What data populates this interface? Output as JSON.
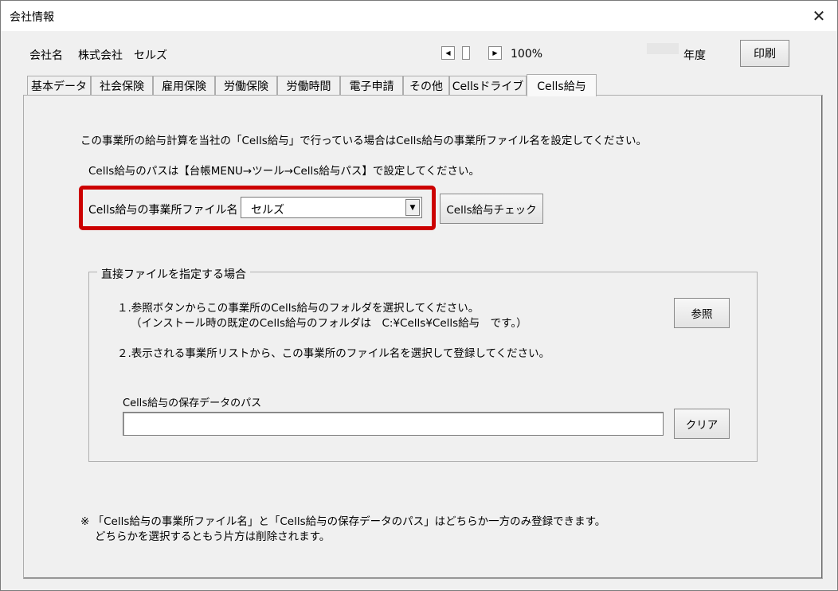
{
  "window": {
    "title": "会社情報",
    "close_label": "✕"
  },
  "header": {
    "company_label": "会社名",
    "company_name": "株式会社　セルズ",
    "zoom": "100%",
    "year_label": "年度",
    "print_label": "印刷"
  },
  "tabs": [
    {
      "label": "基本データ",
      "active": false
    },
    {
      "label": "社会保険",
      "active": false
    },
    {
      "label": "雇用保険",
      "active": false
    },
    {
      "label": "労働保険",
      "active": false
    },
    {
      "label": "労働時間",
      "active": false
    },
    {
      "label": "電子申請",
      "active": false
    },
    {
      "label": "その他",
      "active": false
    },
    {
      "label": "Cellsドライブ",
      "active": false
    },
    {
      "label": "Cells給与",
      "active": true
    }
  ],
  "content": {
    "intro": "この事業所の給与計算を当社の「Cells給与」で行っている場合はCells給与の事業所ファイル名を設定してください。",
    "path_note": "Cells給与のパスは【台帳MENU→ツール→Cells給与パス】で設定してください。",
    "office_file_label": "Cells給与の事業所ファイル名",
    "office_file_value": "セルズ",
    "check_button": "Cells給与チェック",
    "highlight_color": "#cc0000"
  },
  "direct": {
    "group_title": "直接ファイルを指定する場合",
    "step1_line1": "１.参照ボタンからこの事業所のCells給与のフォルダを選択してください。",
    "step1_line2": "（インストール時の既定のCells給与のフォルダは　C:¥Cells¥Cells給与　です。）",
    "step2": "２.表示される事業所リストから、この事業所のファイル名を選択して登録してください。",
    "browse_button": "参照",
    "save_path_label": "Cells給与の保存データのパス",
    "save_path_value": "",
    "clear_button": "クリア"
  },
  "footer": {
    "note_line1": "※ 「Cells給与の事業所ファイル名」と「Cells給与の保存データのパス」はどちらか一方のみ登録できます。",
    "note_line2": "どちらかを選択するともう片方は削除されます。"
  }
}
